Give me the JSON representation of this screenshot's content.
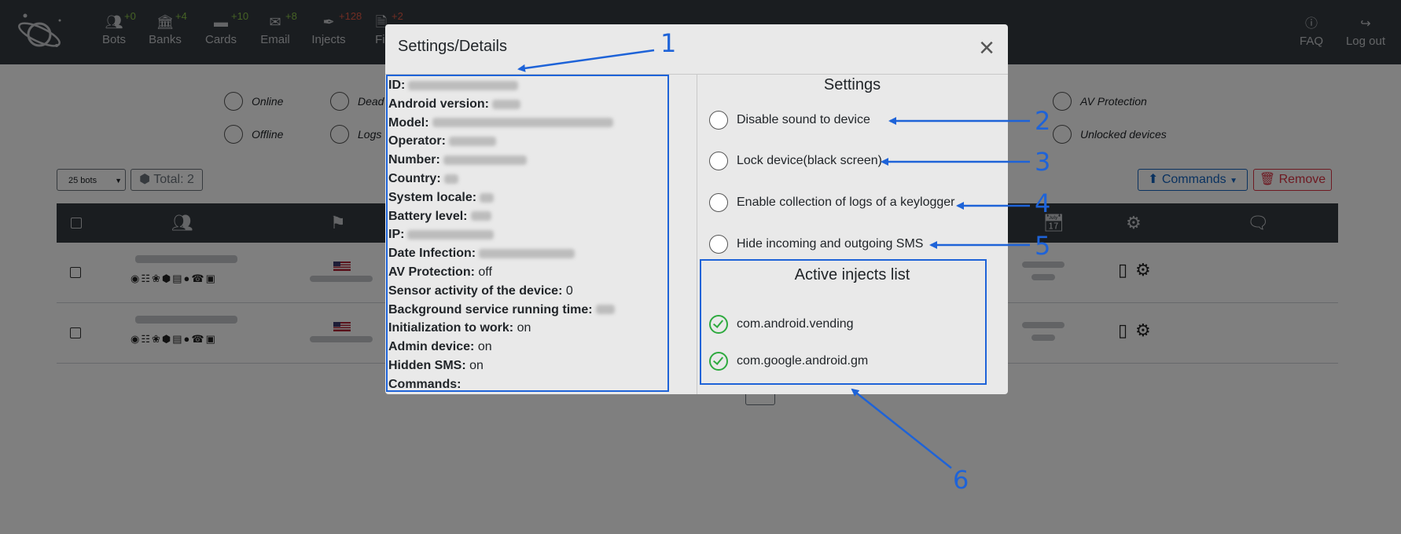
{
  "navbar": {
    "items": [
      {
        "label": "Bots",
        "count": "+0",
        "icon": "users-icon"
      },
      {
        "label": "Banks",
        "count": "+4",
        "icon": "bank-icon"
      },
      {
        "label": "Cards",
        "count": "+10",
        "icon": "credit-card-icon"
      },
      {
        "label": "Email",
        "count": "+8",
        "icon": "envelope-icon"
      },
      {
        "label": "Injects",
        "count": "+128",
        "icon": "syringe-icon"
      },
      {
        "label": "Fil",
        "count": "+2",
        "icon": "file-icon"
      }
    ],
    "right": [
      {
        "label": "FAQ",
        "icon": "info-icon"
      },
      {
        "label": "Log out",
        "icon": "sign-out-icon"
      }
    ]
  },
  "filters": {
    "online": "Online",
    "dead": "Dead",
    "offline": "Offline",
    "logs": "Logs",
    "av_protection": "AV Protection",
    "unlocked_devices": "Unlocked devices"
  },
  "toolbar": {
    "per_page": "25 bots",
    "total": "Total: 2",
    "commands": "Commands",
    "remove": "Remove"
  },
  "modal": {
    "title": "Settings/Details",
    "close": "×",
    "details": [
      {
        "key": "ID:",
        "value": ""
      },
      {
        "key": "Android version:",
        "value": ""
      },
      {
        "key": "Model:",
        "value": ""
      },
      {
        "key": "Operator:",
        "value": ""
      },
      {
        "key": "Number:",
        "value": ""
      },
      {
        "key": "Country:",
        "value": ""
      },
      {
        "key": "System locale:",
        "value": ""
      },
      {
        "key": "Battery level:",
        "value": ""
      },
      {
        "key": "IP:",
        "value": ""
      },
      {
        "key": "Date Infection:",
        "value": ""
      },
      {
        "key": "AV Protection:",
        "value": "off"
      },
      {
        "key": "Sensor activity of the device:",
        "value": "0"
      },
      {
        "key": "Background service running time:",
        "value": ""
      },
      {
        "key": "Initialization to work:",
        "value": "on"
      },
      {
        "key": "Admin device:",
        "value": "on"
      },
      {
        "key": "Hidden SMS:",
        "value": "on"
      },
      {
        "key": "Commands:",
        "value": ""
      }
    ],
    "settings_title": "Settings",
    "settings": [
      "Disable sound to device",
      "Lock device(black screen)",
      "Enable collection of logs of a keylogger",
      "Hide incoming and outgoing SMS"
    ],
    "injects_title": "Active injects list",
    "injects": [
      "com.android.vending",
      "com.google.android.gm"
    ]
  },
  "annotations": [
    "1",
    "2",
    "3",
    "4",
    "5",
    "6"
  ],
  "colors": {
    "navbar": "#343a40",
    "annotation": "#1e63d8",
    "inject_ok": "#2eaa3f",
    "commands": "#1565c0",
    "remove": "#dc3545"
  }
}
